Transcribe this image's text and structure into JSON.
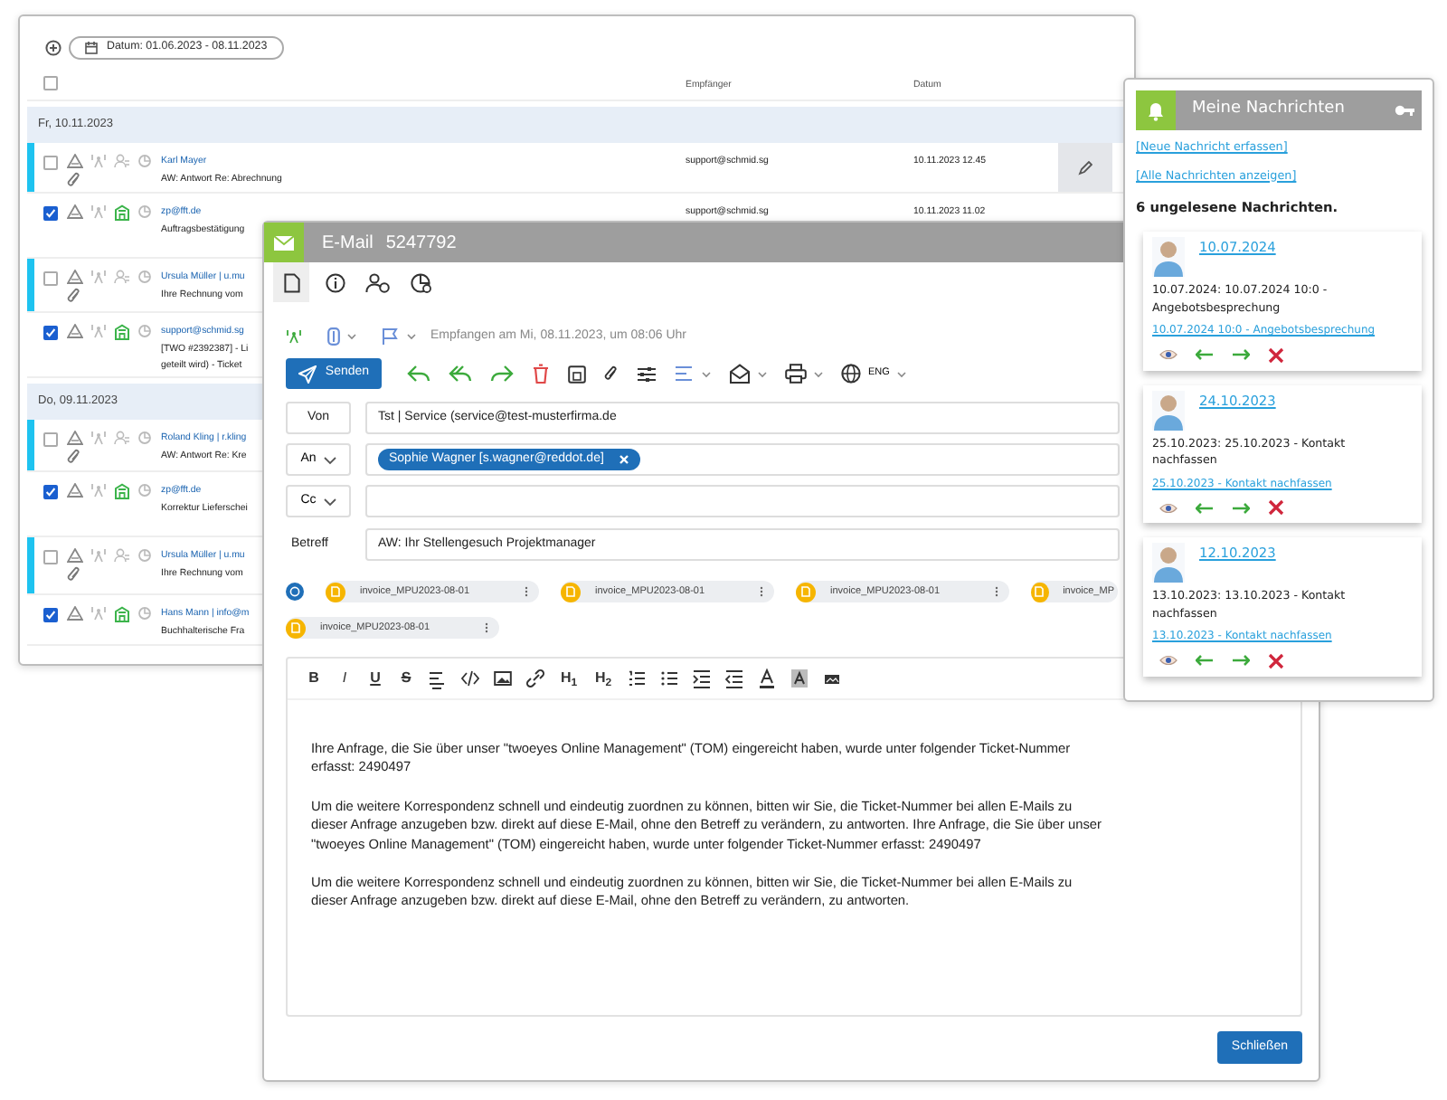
{
  "list_window": {
    "filter_chip": "Datum: 01.06.2023 - 08.11.2023",
    "select_all_checked": false,
    "columns": [
      "Empfänger",
      "Datum"
    ],
    "groups": [
      {
        "date": "Fr, 10.11.2023",
        "rows": [
          {
            "unread": true,
            "checked": false,
            "attachment": true,
            "assigned": false,
            "lines": [
              "Karl Mayer",
              "AW: Antwort Re: Abrechnung"
            ],
            "recipient": "support@schmid.sg",
            "date": "10.11.2023 12.45",
            "editable": true
          },
          {
            "unread": false,
            "checked": true,
            "attachment": false,
            "assigned": true,
            "lines": [
              "zp@fft.de",
              "Auftragsbestätigung"
            ],
            "recipient": "support@schmid.sg",
            "date": "10.11.2023 11.02",
            "editable": false
          },
          {
            "unread": true,
            "checked": false,
            "attachment": true,
            "assigned": false,
            "lines": [
              "Ursula Müller | u.mu",
              "Ihre Rechnung vom"
            ]
          },
          {
            "unread": false,
            "checked": true,
            "attachment": false,
            "assigned": true,
            "lines": [
              "support@schmid.sg",
              "[TWO #2392387] - Li",
              "geteilt wird) - Ticket"
            ]
          }
        ]
      },
      {
        "date": "Do, 09.11.2023",
        "rows": [
          {
            "unread": true,
            "checked": false,
            "attachment": true,
            "assigned": false,
            "lines": [
              "Roland Kling | r.kling",
              "AW: Antwort Re: Kre"
            ]
          },
          {
            "unread": false,
            "checked": true,
            "attachment": false,
            "assigned": true,
            "lines": [
              "zp@fft.de",
              "Korrektur Lieferschei"
            ]
          },
          {
            "unread": true,
            "checked": false,
            "attachment": true,
            "assigned": false,
            "lines": [
              "Ursula Müller | u.mu",
              "Ihre Rechnung vom"
            ]
          },
          {
            "unread": false,
            "checked": true,
            "attachment": false,
            "assigned": true,
            "lines": [
              "Hans Mann | info@m",
              "Buchhalterische Fra"
            ]
          }
        ]
      }
    ]
  },
  "email_window": {
    "title": "E-Mail",
    "number": "5247792",
    "tabs": [
      {
        "selected": true
      },
      {
        "selected": false
      },
      {
        "selected": false
      },
      {
        "selected": false
      }
    ],
    "received": "Empfangen am Mi, 08.11.2023, um 08:06 Uhr",
    "send_button": "Senden",
    "language": "ENG",
    "fields": [
      {
        "kind": "boxed",
        "label": "Von",
        "value": "Tst | Service (service@test-musterfirma.de"
      },
      {
        "kind": "dropdown",
        "label": "An",
        "tokens": [
          "Sophie Wagner [s.wagner@reddot.de]"
        ]
      },
      {
        "kind": "dropdown",
        "label": "Cc"
      },
      {
        "kind": "bare",
        "label": "Betreff",
        "value": "AW: Ihr Stellengesuch Projektmanager"
      }
    ],
    "attachments": [
      {
        "name": "invoice_MPU2023-08-01",
        "cut": false
      },
      {
        "name": "invoice_MPU2023-08-01",
        "cut": false
      },
      {
        "name": "invoice_MPU2023-08-01",
        "cut": false
      },
      {
        "name": "invoice_MP",
        "cut": true
      },
      {
        "name": "invoice_MPU2023-08-01",
        "cut": false
      }
    ],
    "format_buttons": [
      "B",
      "I",
      "U",
      "S",
      "H$_{1}$",
      "H$_{2}$"
    ],
    "body": [
      "Ihre Anfrage, die Sie über unser \"twoeyes Online Management\" (TOM) eingereicht haben, wurde unter folgender Ticket-Nummer erfasst: 2490497",
      "Um die weitere Korrespondenz schnell und eindeutig zuordnen zu können, bitten wir Sie, die Ticket-Nummer bei allen E-Mails zu dieser Anfrage anzugeben bzw. direkt auf diese E-Mail, ohne den Betreff zu verändern, zu antworten. Ihre Anfrage, die Sie über unser \"twoeyes Online Management\" (TOM) eingereicht haben, wurde unter folgender Ticket-Nummer erfasst: 2490497",
      "Um die weitere Korrespondenz schnell und eindeutig zuordnen zu können, bitten wir Sie, die Ticket-Nummer bei allen E-Mails zu dieser Anfrage anzugeben bzw. direkt auf diese E-Mail, ohne den Betreff zu verändern, zu antworten."
    ],
    "close_button": "Schließen"
  },
  "messages_panel": {
    "title": "Meine Nachrichten",
    "links": [
      "[Neue Nachricht erfassen]",
      "[Alle Nachrichten anzeigen]"
    ],
    "summary": "6 ungelesene Nachrichten.",
    "messages": [
      {
        "date": "10.07.2024",
        "text": "10.07.2024: 10.07.2024 10:0 - Angebotsbesprechung",
        "link": "10.07.2024 10:0 - Angebotsbesprechung"
      },
      {
        "date": "24.10.2023",
        "text": "25.10.2023: 25.10.2023 - Kontakt nachfassen",
        "link": "25.10.2023 - Kontakt nachfassen"
      },
      {
        "date": "12.10.2023",
        "text": "13.10.2023: 13.10.2023 - Kontakt nachfassen",
        "link": "13.10.2023 - Kontakt nachfassen"
      }
    ]
  }
}
